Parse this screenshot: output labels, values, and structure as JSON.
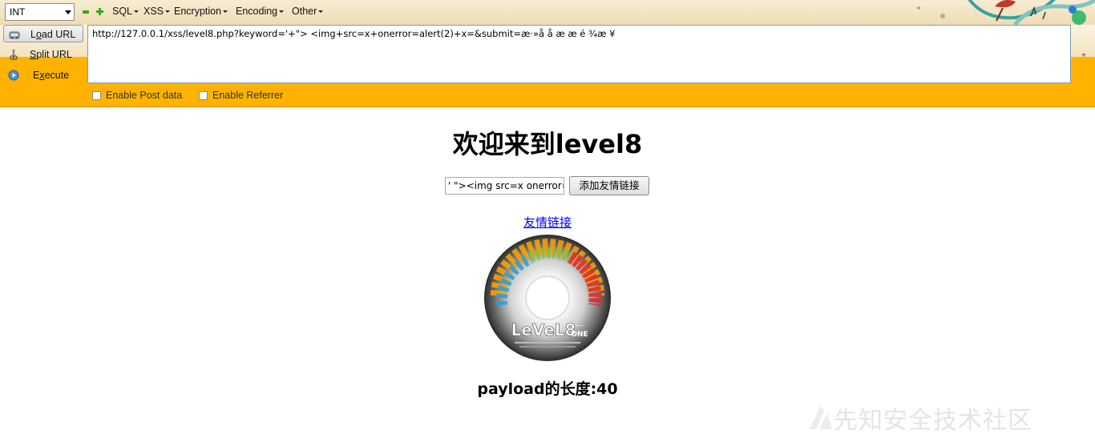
{
  "hackbar": {
    "select_value": "INT",
    "menus": [
      "SQL",
      "XSS",
      "Encryption",
      "Encoding",
      "Other"
    ],
    "load_url_label_pre": "L",
    "load_url_label_u": "o",
    "load_url_label_post": "ad URL",
    "split_url_label_pre": "",
    "split_url_label_u": "S",
    "split_url_label_post": "plit URL",
    "execute_label_pre": "E",
    "execute_label_u": "x",
    "execute_label_post": "ecute",
    "url_value": "http://127.0.0.1/xss/level8.php?keyword='+\"> <img+src=x+onerror=alert(2)+x=&submit=æ·»å  å æ æ é ¾æ ¥",
    "scroll_plus": "+",
    "enable_post": "Enable Post data",
    "enable_referrer": "Enable Referrer"
  },
  "page": {
    "title": "欢迎来到level8",
    "keyword_value": "' \"><img src=x onerror=",
    "submit_label": "添加友情链接",
    "friend_link": "友情链接",
    "disc_text": "LeVeL8",
    "disc_small": "一一",
    "disc_small2": "ONE",
    "payload_length": "payload的长度:40"
  },
  "watermark": {
    "text": "先知安全技术社区"
  },
  "colors": {
    "hackbar_bg": "#ffb300",
    "link": "#0000ee"
  }
}
